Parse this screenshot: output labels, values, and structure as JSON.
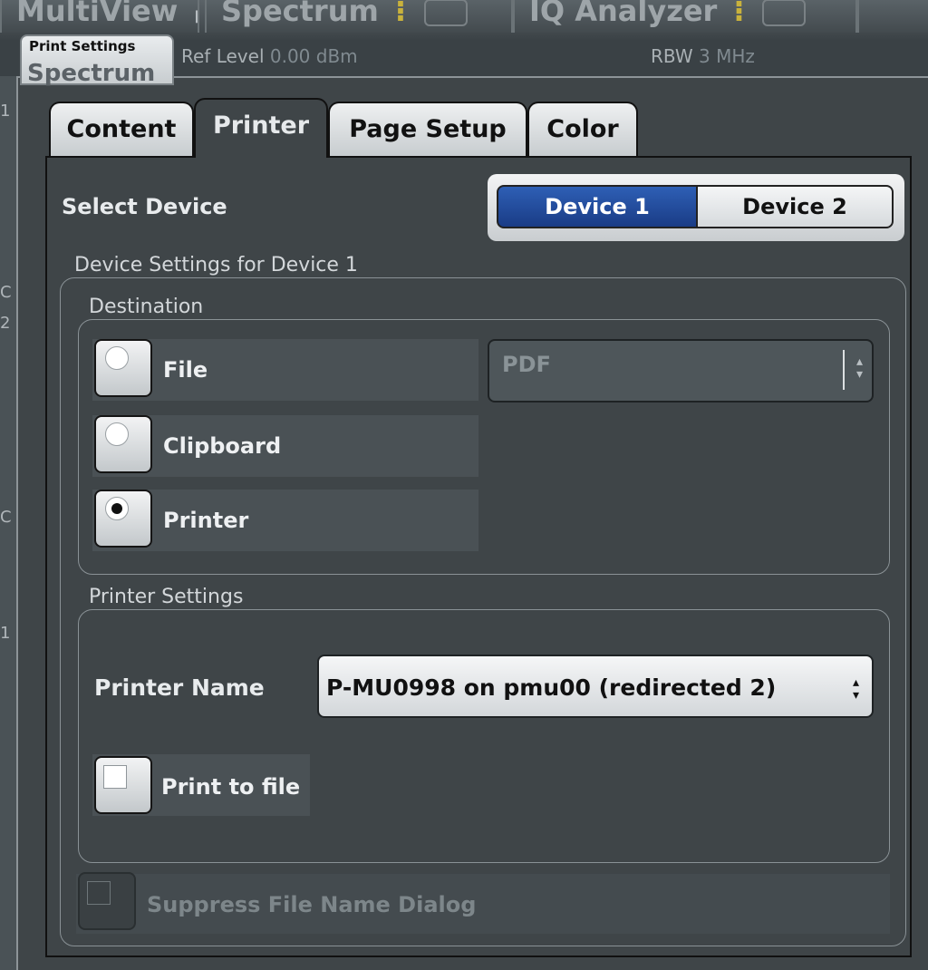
{
  "background": {
    "tabs": [
      {
        "label": "MultiView",
        "marker": "■■"
      },
      {
        "label": "Spectrum",
        "marker": "⁝"
      },
      {
        "label": "IQ Analyzer",
        "marker": "⁝"
      }
    ],
    "ref_level_label": "Ref Level",
    "ref_level_value": "0.00 dBm",
    "rbw_label": "RBW",
    "rbw_value": "3 MHz",
    "edge_marks": [
      "1",
      "C",
      "2",
      "C",
      "1"
    ]
  },
  "dialog": {
    "title": "Print Settings",
    "ghost_title": "Spectrum",
    "tabs": [
      {
        "label": "Content",
        "active": false
      },
      {
        "label": "Printer",
        "active": true
      },
      {
        "label": "Page Setup",
        "active": false
      },
      {
        "label": "Color",
        "active": false
      }
    ],
    "select_device": {
      "label": "Select Device",
      "options": [
        "Device 1",
        "Device 2"
      ],
      "selected": "Device 1"
    },
    "device_settings_title": "Device Settings for Device 1",
    "destination": {
      "title": "Destination",
      "options": [
        {
          "label": "File",
          "selected": false
        },
        {
          "label": "Clipboard",
          "selected": false
        },
        {
          "label": "Printer",
          "selected": true
        }
      ],
      "file_format": {
        "value": "PDF",
        "enabled": false
      }
    },
    "printer_settings": {
      "title": "Printer Settings",
      "printer_name_label": "Printer Name",
      "printer_name_value": "P-MU0998 on pmu00 (redirected 2)",
      "print_to_file": {
        "label": "Print to file",
        "checked": false
      }
    },
    "suppress_dialog": {
      "label": "Suppress File Name Dialog",
      "checked": false,
      "enabled": false
    }
  },
  "colors": {
    "accent": "#2e5fb5",
    "panel": "#3f4548"
  }
}
